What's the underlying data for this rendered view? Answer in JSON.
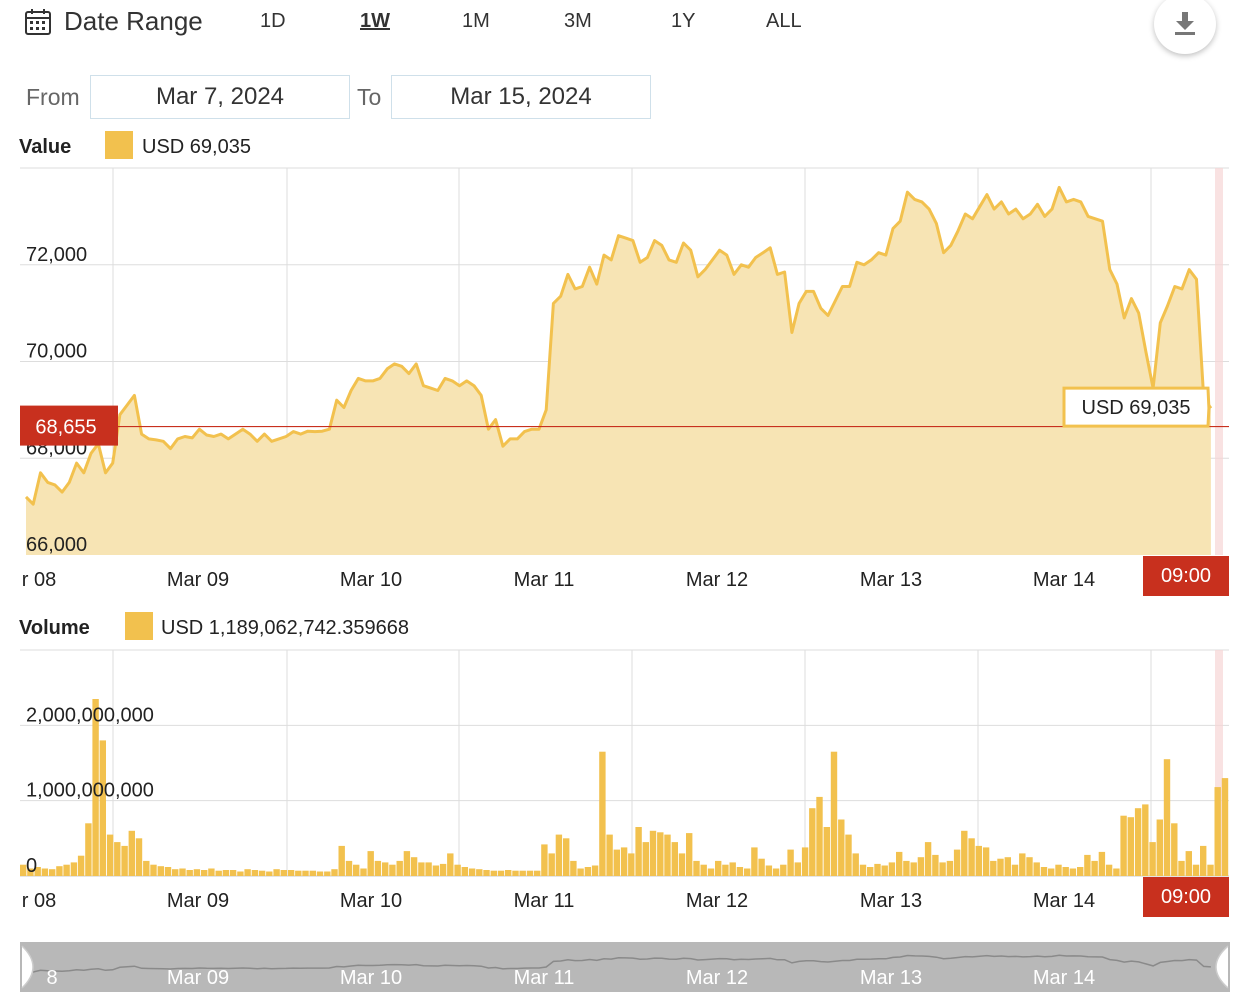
{
  "toolbar": {
    "title": "Date Range",
    "ranges": [
      "1D",
      "1W",
      "1M",
      "3M",
      "1Y",
      "ALL"
    ],
    "active_range": "1W",
    "from_label": "From",
    "to_label": "To",
    "from_value": "Mar 7, 2024",
    "to_value": "Mar 15, 2024"
  },
  "colors": {
    "series": "#f2c14e",
    "fill": "#f7e4b4",
    "marker": "#c8301e",
    "grid": "#dddddd"
  },
  "value_panel": {
    "label": "Value",
    "legend_text": "USD 69,035",
    "marker_label": "68,655",
    "time_badge": "09:00",
    "tooltip_text": "USD 69,035"
  },
  "volume_panel": {
    "label": "Volume",
    "legend_text": "USD 1,189,062,742.359668",
    "time_badge": "09:00"
  },
  "navigator": {
    "labels": [
      "8",
      "Mar 09",
      "Mar 10",
      "Mar 11",
      "Mar 12",
      "Mar 13",
      "Mar 14"
    ]
  },
  "chart_data": [
    {
      "type": "area",
      "name": "Value",
      "xlabels": [
        "r 08",
        "Mar 09",
        "Mar 10",
        "Mar 11",
        "Mar 12",
        "Mar 13",
        "Mar 14"
      ],
      "yticks": [
        "72,000",
        "70,000",
        "68,000",
        "66,000"
      ],
      "ylim": [
        66000,
        74000
      ],
      "reference_line": 68655,
      "last_value": 69035,
      "points": [
        [
          "Mar 08 00:00",
          67200
        ],
        [
          "Mar 08 01:00",
          67050
        ],
        [
          "Mar 08 02:00",
          67700
        ],
        [
          "Mar 08 03:00",
          67500
        ],
        [
          "Mar 08 04:00",
          67450
        ],
        [
          "Mar 08 05:00",
          67300
        ],
        [
          "Mar 08 06:00",
          67500
        ],
        [
          "Mar 08 07:00",
          67900
        ],
        [
          "Mar 08 08:00",
          67700
        ],
        [
          "Mar 08 09:00",
          68100
        ],
        [
          "Mar 08 10:00",
          68300
        ],
        [
          "Mar 08 11:00",
          67700
        ],
        [
          "Mar 08 12:00",
          67900
        ],
        [
          "Mar 08 13:00",
          68900
        ],
        [
          "Mar 08 14:00",
          69100
        ],
        [
          "Mar 08 15:00",
          69300
        ],
        [
          "Mar 08 16:00",
          68500
        ],
        [
          "Mar 08 17:00",
          68400
        ],
        [
          "Mar 08 18:00",
          68380
        ],
        [
          "Mar 08 19:00",
          68350
        ],
        [
          "Mar 08 20:00",
          68200
        ],
        [
          "Mar 08 21:00",
          68400
        ],
        [
          "Mar 08 22:00",
          68450
        ],
        [
          "Mar 08 23:00",
          68420
        ],
        [
          "Mar 09 00:00",
          68600
        ],
        [
          "Mar 09 01:00",
          68480
        ],
        [
          "Mar 09 02:00",
          68450
        ],
        [
          "Mar 09 03:00",
          68500
        ],
        [
          "Mar 09 04:00",
          68400
        ],
        [
          "Mar 09 05:00",
          68500
        ],
        [
          "Mar 09 06:00",
          68600
        ],
        [
          "Mar 09 07:00",
          68500
        ],
        [
          "Mar 09 08:00",
          68350
        ],
        [
          "Mar 09 09:00",
          68500
        ],
        [
          "Mar 09 10:00",
          68350
        ],
        [
          "Mar 09 11:00",
          68400
        ],
        [
          "Mar 09 12:00",
          68450
        ],
        [
          "Mar 09 13:00",
          68550
        ],
        [
          "Mar 09 14:00",
          68500
        ],
        [
          "Mar 09 15:00",
          68560
        ],
        [
          "Mar 09 16:00",
          68550
        ],
        [
          "Mar 09 17:00",
          68560
        ],
        [
          "Mar 09 18:00",
          68600
        ],
        [
          "Mar 09 19:00",
          69200
        ],
        [
          "Mar 09 20:00",
          69050
        ],
        [
          "Mar 09 21:00",
          69400
        ],
        [
          "Mar 09 22:00",
          69650
        ],
        [
          "Mar 09 23:00",
          69600
        ],
        [
          "Mar 10 00:00",
          69600
        ],
        [
          "Mar 10 01:00",
          69650
        ],
        [
          "Mar 10 02:00",
          69850
        ],
        [
          "Mar 10 03:00",
          69950
        ],
        [
          "Mar 10 04:00",
          69900
        ],
        [
          "Mar 10 05:00",
          69750
        ],
        [
          "Mar 10 06:00",
          69950
        ],
        [
          "Mar 10 07:00",
          69500
        ],
        [
          "Mar 10 08:00",
          69450
        ],
        [
          "Mar 10 09:00",
          69400
        ],
        [
          "Mar 10 10:00",
          69650
        ],
        [
          "Mar 10 11:00",
          69600
        ],
        [
          "Mar 10 12:00",
          69500
        ],
        [
          "Mar 10 13:00",
          69600
        ],
        [
          "Mar 10 14:00",
          69500
        ],
        [
          "Mar 10 15:00",
          69300
        ],
        [
          "Mar 10 16:00",
          68600
        ],
        [
          "Mar 10 17:00",
          68800
        ],
        [
          "Mar 10 18:00",
          68250
        ],
        [
          "Mar 10 19:00",
          68400
        ],
        [
          "Mar 10 20:00",
          68400
        ],
        [
          "Mar 10 21:00",
          68550
        ],
        [
          "Mar 10 22:00",
          68600
        ],
        [
          "Mar 10 23:00",
          68600
        ],
        [
          "Mar 11 00:00",
          69000
        ],
        [
          "Mar 11 01:00",
          71200
        ],
        [
          "Mar 11 02:00",
          71350
        ],
        [
          "Mar 11 03:00",
          71800
        ],
        [
          "Mar 11 04:00",
          71500
        ],
        [
          "Mar 11 05:00",
          71550
        ],
        [
          "Mar 11 06:00",
          71950
        ],
        [
          "Mar 11 07:00",
          71600
        ],
        [
          "Mar 11 08:00",
          72200
        ],
        [
          "Mar 11 09:00",
          72100
        ],
        [
          "Mar 11 10:00",
          72600
        ],
        [
          "Mar 11 11:00",
          72550
        ],
        [
          "Mar 11 12:00",
          72500
        ],
        [
          "Mar 11 13:00",
          72050
        ],
        [
          "Mar 11 14:00",
          72150
        ],
        [
          "Mar 11 15:00",
          72500
        ],
        [
          "Mar 11 16:00",
          72400
        ],
        [
          "Mar 11 17:00",
          72100
        ],
        [
          "Mar 11 18:00",
          72050
        ],
        [
          "Mar 11 19:00",
          72450
        ],
        [
          "Mar 11 20:00",
          72300
        ],
        [
          "Mar 11 21:00",
          71750
        ],
        [
          "Mar 11 22:00",
          71900
        ],
        [
          "Mar 11 23:00",
          72100
        ],
        [
          "Mar 12 00:00",
          72300
        ],
        [
          "Mar 12 01:00",
          72200
        ],
        [
          "Mar 12 02:00",
          71800
        ],
        [
          "Mar 12 03:00",
          72000
        ],
        [
          "Mar 12 04:00",
          71950
        ],
        [
          "Mar 12 05:00",
          72150
        ],
        [
          "Mar 12 06:00",
          72250
        ],
        [
          "Mar 12 07:00",
          72350
        ],
        [
          "Mar 12 08:00",
          71800
        ],
        [
          "Mar 12 09:00",
          71850
        ],
        [
          "Mar 12 10:00",
          70600
        ],
        [
          "Mar 12 11:00",
          71200
        ],
        [
          "Mar 12 12:00",
          71450
        ],
        [
          "Mar 12 13:00",
          71450
        ],
        [
          "Mar 12 14:00",
          71100
        ],
        [
          "Mar 12 15:00",
          70950
        ],
        [
          "Mar 12 16:00",
          71250
        ],
        [
          "Mar 12 17:00",
          71550
        ],
        [
          "Mar 12 18:00",
          71550
        ],
        [
          "Mar 12 19:00",
          72050
        ],
        [
          "Mar 12 20:00",
          72000
        ],
        [
          "Mar 12 21:00",
          72100
        ],
        [
          "Mar 12 22:00",
          72250
        ],
        [
          "Mar 12 23:00",
          72200
        ],
        [
          "Mar 13 00:00",
          72750
        ],
        [
          "Mar 13 01:00",
          72900
        ],
        [
          "Mar 13 02:00",
          73500
        ],
        [
          "Mar 13 03:00",
          73350
        ],
        [
          "Mar 13 04:00",
          73300
        ],
        [
          "Mar 13 05:00",
          73150
        ],
        [
          "Mar 13 06:00",
          72850
        ],
        [
          "Mar 13 07:00",
          72250
        ],
        [
          "Mar 13 08:00",
          72400
        ],
        [
          "Mar 13 09:00",
          72700
        ],
        [
          "Mar 13 10:00",
          73050
        ],
        [
          "Mar 13 11:00",
          72950
        ],
        [
          "Mar 13 12:00",
          73200
        ],
        [
          "Mar 13 13:00",
          73450
        ],
        [
          "Mar 13 14:00",
          73150
        ],
        [
          "Mar 13 15:00",
          73300
        ],
        [
          "Mar 13 16:00",
          73050
        ],
        [
          "Mar 13 17:00",
          73150
        ],
        [
          "Mar 13 18:00",
          72950
        ],
        [
          "Mar 13 19:00",
          73050
        ],
        [
          "Mar 13 20:00",
          73250
        ],
        [
          "Mar 13 21:00",
          73000
        ],
        [
          "Mar 13 22:00",
          73150
        ],
        [
          "Mar 13 23:00",
          73600
        ],
        [
          "Mar 14 00:00",
          73300
        ],
        [
          "Mar 14 01:00",
          73350
        ],
        [
          "Mar 14 02:00",
          73300
        ],
        [
          "Mar 14 03:00",
          73000
        ],
        [
          "Mar 14 04:00",
          72950
        ],
        [
          "Mar 14 05:00",
          72900
        ],
        [
          "Mar 14 06:00",
          71900
        ],
        [
          "Mar 14 07:00",
          71600
        ],
        [
          "Mar 14 08:00",
          70900
        ],
        [
          "Mar 14 09:00",
          71300
        ],
        [
          "Mar 14 10:00",
          71000
        ],
        [
          "Mar 14 11:00",
          70200
        ],
        [
          "Mar 14 12:00",
          69450
        ],
        [
          "Mar 14 13:00",
          70800
        ],
        [
          "Mar 14 14:00",
          71150
        ],
        [
          "Mar 14 15:00",
          71550
        ],
        [
          "Mar 14 16:00",
          71500
        ],
        [
          "Mar 14 17:00",
          71900
        ],
        [
          "Mar 14 18:00",
          71700
        ],
        [
          "Mar 14 19:00",
          69250
        ],
        [
          "Mar 14 20:00",
          69035
        ]
      ]
    },
    {
      "type": "bar",
      "name": "Volume",
      "xlabels": [
        "r 08",
        "Mar 09",
        "Mar 10",
        "Mar 11",
        "Mar 12",
        "Mar 13",
        "Mar 14"
      ],
      "yticks": [
        "2,000,000,000",
        "1,000,000,000",
        "0"
      ],
      "ylim": [
        0,
        3000000000
      ],
      "values": [
        150000000,
        100000000,
        120000000,
        100000000,
        90000000,
        130000000,
        150000000,
        180000000,
        270000000,
        700000000,
        2350000000,
        1800000000,
        550000000,
        450000000,
        400000000,
        600000000,
        500000000,
        200000000,
        150000000,
        130000000,
        120000000,
        90000000,
        100000000,
        80000000,
        90000000,
        80000000,
        100000000,
        70000000,
        80000000,
        80000000,
        60000000,
        90000000,
        80000000,
        70000000,
        60000000,
        90000000,
        80000000,
        80000000,
        70000000,
        70000000,
        70000000,
        60000000,
        60000000,
        90000000,
        400000000,
        200000000,
        150000000,
        100000000,
        330000000,
        200000000,
        180000000,
        150000000,
        200000000,
        330000000,
        250000000,
        180000000,
        180000000,
        140000000,
        160000000,
        300000000,
        150000000,
        120000000,
        100000000,
        90000000,
        80000000,
        70000000,
        70000000,
        80000000,
        70000000,
        70000000,
        70000000,
        70000000,
        420000000,
        300000000,
        550000000,
        500000000,
        200000000,
        100000000,
        120000000,
        140000000,
        1650000000,
        550000000,
        350000000,
        380000000,
        300000000,
        650000000,
        450000000,
        600000000,
        580000000,
        550000000,
        450000000,
        300000000,
        570000000,
        200000000,
        150000000,
        100000000,
        200000000,
        150000000,
        180000000,
        120000000,
        100000000,
        380000000,
        230000000,
        140000000,
        100000000,
        150000000,
        350000000,
        180000000,
        380000000,
        900000000,
        1050000000,
        650000000,
        1650000000,
        750000000,
        550000000,
        300000000,
        150000000,
        120000000,
        160000000,
        140000000,
        180000000,
        320000000,
        200000000,
        180000000,
        250000000,
        450000000,
        280000000,
        180000000,
        200000000,
        350000000,
        600000000,
        500000000,
        400000000,
        380000000,
        200000000,
        230000000,
        250000000,
        150000000,
        300000000,
        250000000,
        180000000,
        120000000,
        100000000,
        150000000,
        120000000,
        100000000,
        120000000,
        280000000,
        200000000,
        320000000,
        150000000,
        100000000,
        800000000,
        780000000,
        900000000,
        950000000,
        450000000,
        750000000,
        1550000000,
        700000000,
        200000000,
        330000000,
        150000000,
        400000000,
        150000000,
        1180000000,
        1300000000
      ]
    }
  ]
}
